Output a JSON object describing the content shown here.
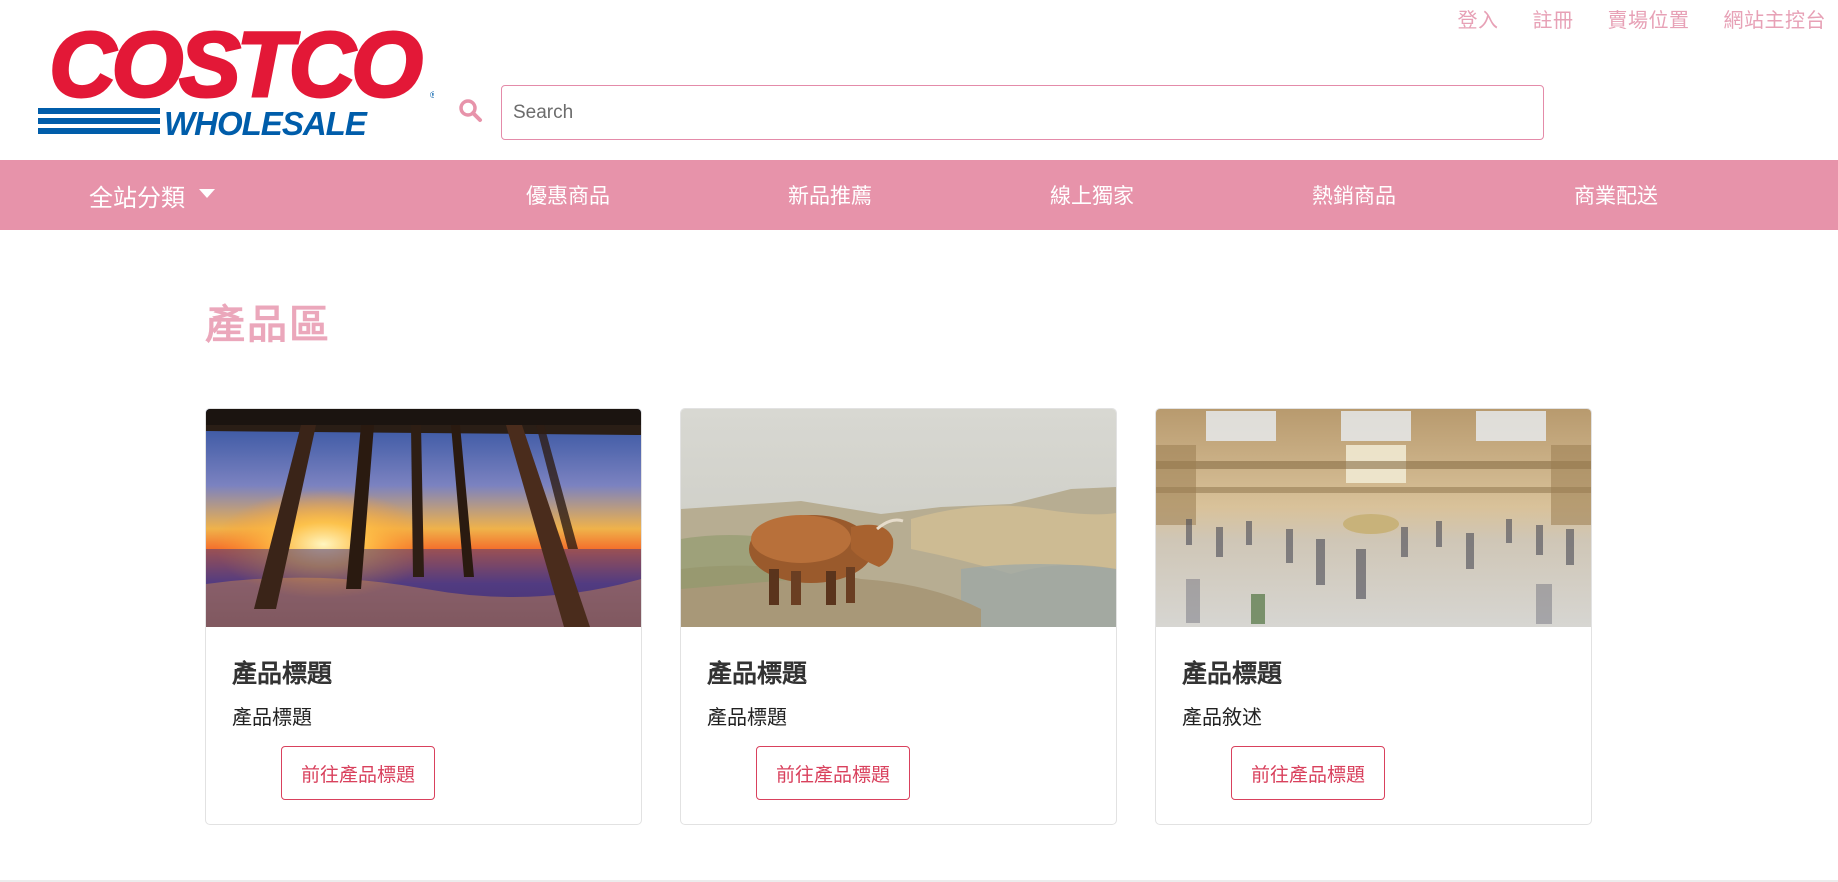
{
  "top_links": [
    "登入",
    "註冊",
    "賣場位置",
    "網站主控台"
  ],
  "logo": {
    "line1": "COSTCO",
    "line2": "WHOLESALE",
    "icon": "costco-logo"
  },
  "search": {
    "placeholder": "Search",
    "value": "",
    "icon": "search-icon"
  },
  "nav": {
    "category_label": "全站分類",
    "items": [
      "優惠商品",
      "新品推薦",
      "線上獨家",
      "熱銷商品",
      "商業配送"
    ]
  },
  "section_title": "產品區",
  "products": [
    {
      "title": "產品標題",
      "text": "產品標題",
      "button": "前往產品標題",
      "image": "pier-sunset-photo"
    },
    {
      "title": "產品標題",
      "text": "產品標題",
      "button": "前往產品標題",
      "image": "highland-cow-photo"
    },
    {
      "title": "產品標題",
      "text": "產品敘述",
      "button": "前往產品標題",
      "image": "train-station-hall-photo"
    }
  ],
  "colors": {
    "brand_red": "#e31837",
    "brand_blue": "#005daa",
    "nav_pink": "#e793aa",
    "link_pink": "#e7a1b6",
    "button_red": "#d9415d"
  }
}
